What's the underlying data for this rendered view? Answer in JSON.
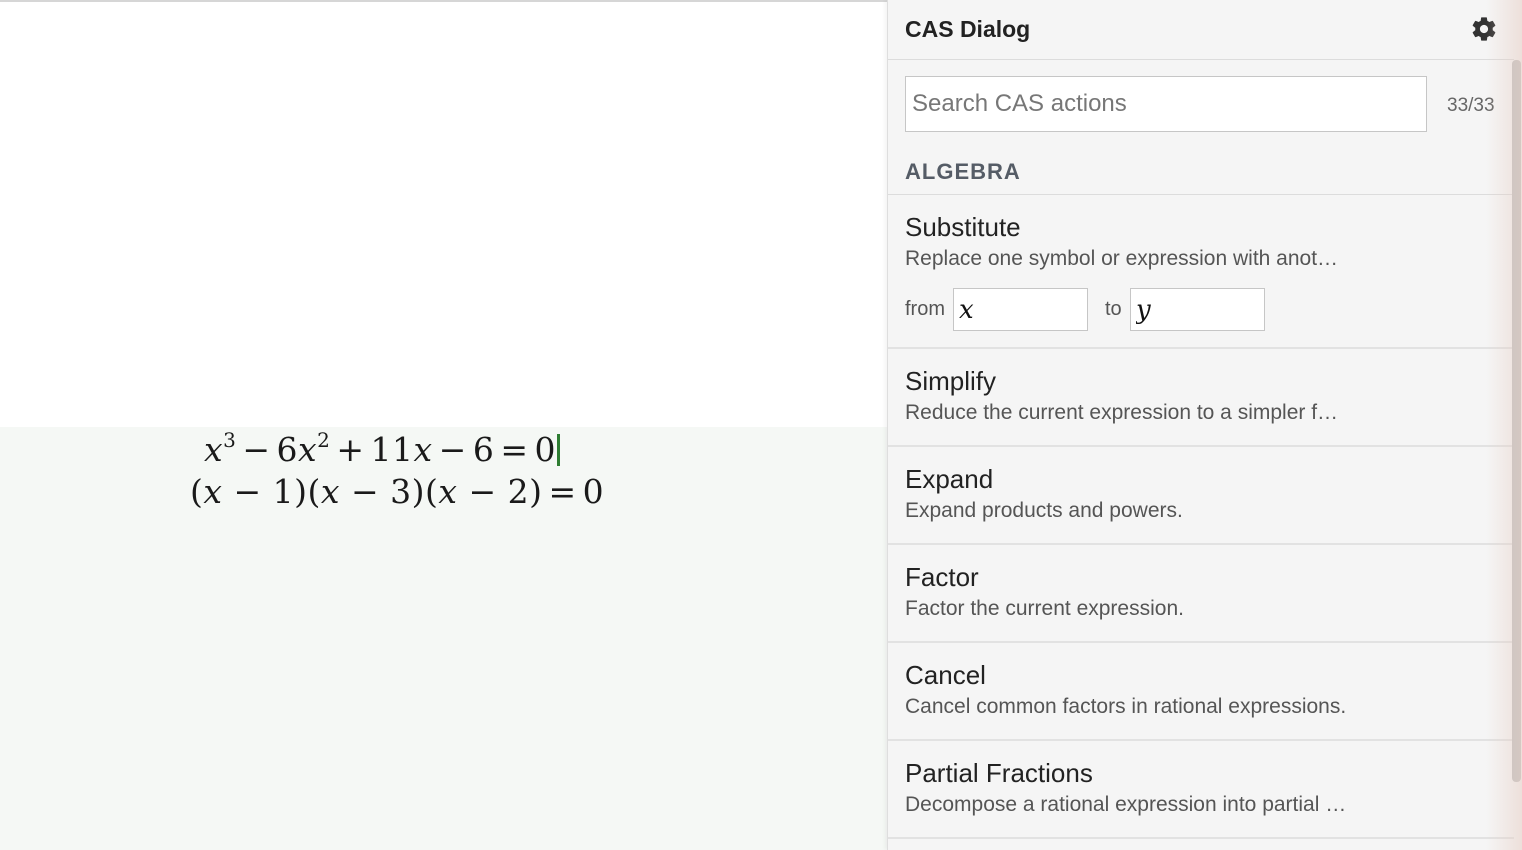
{
  "editor": {
    "line1": {
      "x": "x",
      "exp1": "3",
      "minus1": "−",
      "coef": "6",
      "x2": "x",
      "exp2": "2",
      "plus": "+",
      "coef2": "11",
      "x3": "x",
      "minus2": "−",
      "const": "6",
      "eq": "=",
      "rhs": "0"
    },
    "line2": {
      "f1_open": "(",
      "f1_var": "x",
      "f1_rest": " − 1)",
      "f2_open": "(",
      "f2_var": "x",
      "f2_rest": " − 3)",
      "f3_open": "(",
      "f3_var": "x",
      "f3_rest": " − 2)",
      "eq": "=",
      "rhs": "0"
    },
    "caret_color": "#2e7d32"
  },
  "panel": {
    "title": "CAS Dialog",
    "settings_icon": "gear-icon",
    "search": {
      "placeholder": "Search CAS actions",
      "value": ""
    },
    "count": "33/33",
    "section": "ALGEBRA",
    "actions": [
      {
        "title": "Substitute",
        "desc": "Replace one symbol or expression with anot…",
        "from_label": "from",
        "from_value": "x",
        "to_label": "to",
        "to_value": "y"
      },
      {
        "title": "Simplify",
        "desc": "Reduce the current expression to a simpler f…"
      },
      {
        "title": "Expand",
        "desc": "Expand products and powers."
      },
      {
        "title": "Factor",
        "desc": "Factor the current expression."
      },
      {
        "title": "Cancel",
        "desc": "Cancel common factors in rational expressions."
      },
      {
        "title": "Partial Fractions",
        "desc": "Decompose a rational expression into partial …"
      }
    ]
  }
}
